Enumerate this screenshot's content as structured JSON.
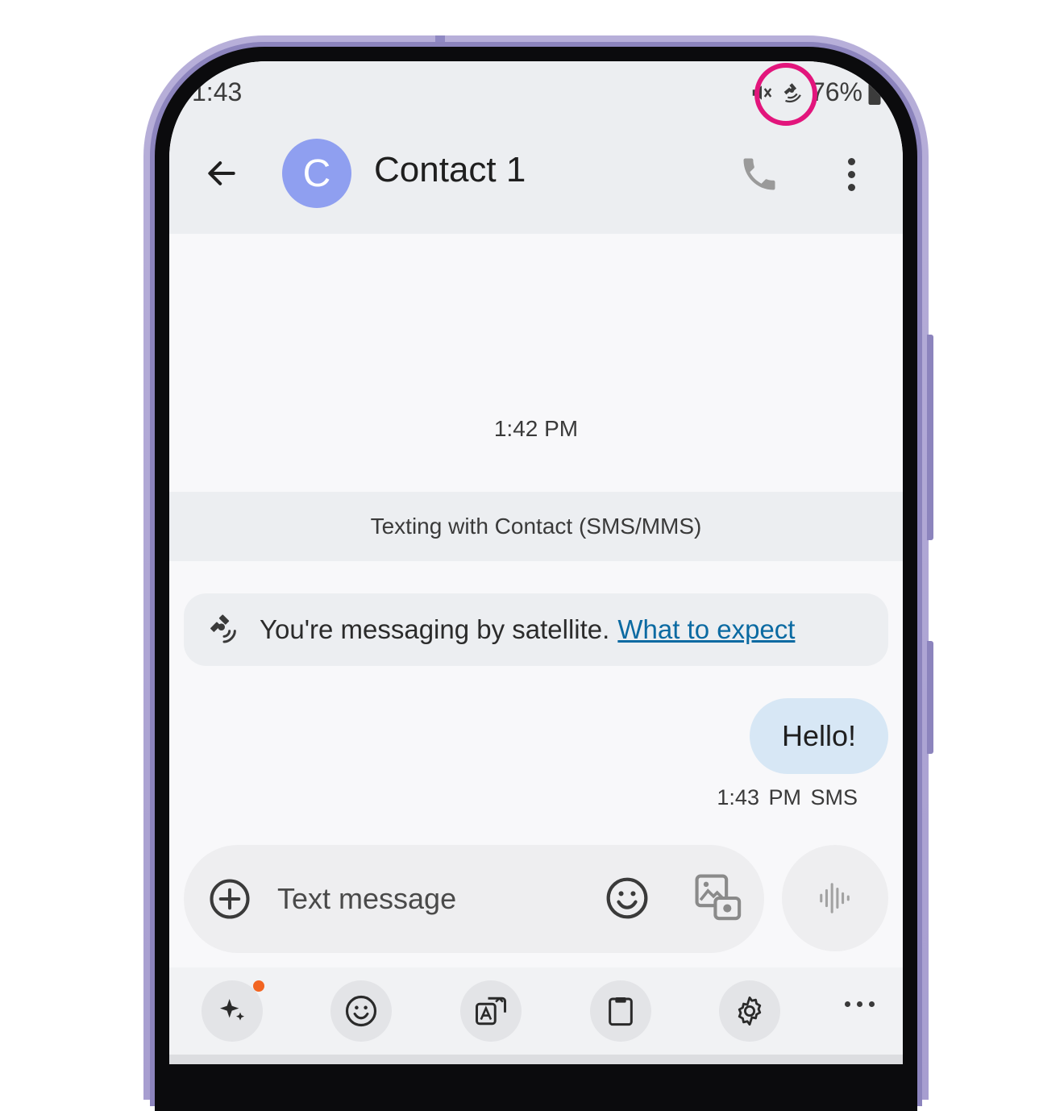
{
  "status_bar": {
    "time": "1:43",
    "battery_text": "76%"
  },
  "header": {
    "avatar_letter": "C",
    "contact_name": "Contact 1"
  },
  "conversation": {
    "timestamp": "1:42 PM",
    "sms_banner": "Texting with Contact (SMS/MMS)",
    "satellite_notice": {
      "text": "You're messaging by satellite.",
      "link": "What to expect"
    },
    "messages": [
      {
        "text": "Hello!",
        "time": "1:43 PM",
        "type": "SMS"
      }
    ]
  },
  "composer": {
    "placeholder": "Text message"
  },
  "colors": {
    "accent_ring": "#e2157c",
    "avatar_bg": "#8f9ff0",
    "bubble_bg": "#d7e7f5",
    "link": "#0b6aa2"
  }
}
